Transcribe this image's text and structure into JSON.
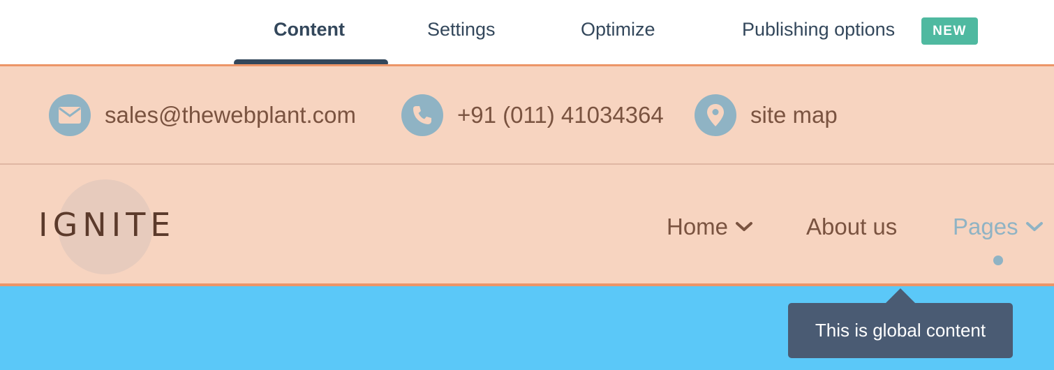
{
  "tabs": [
    {
      "label": "Content",
      "active": true
    },
    {
      "label": "Settings",
      "active": false
    },
    {
      "label": "Optimize",
      "active": false
    },
    {
      "label": "Publishing options",
      "active": false,
      "badge": "NEW"
    }
  ],
  "header": {
    "contacts": [
      {
        "icon": "envelope-icon",
        "text": "sales@thewebplant.com"
      },
      {
        "icon": "phone-icon",
        "text": "+91 (011) 41034364"
      },
      {
        "icon": "map-pin-icon",
        "text": "site map"
      }
    ],
    "logo": "IGNITE",
    "nav": [
      {
        "label": "Home",
        "has_dropdown": true,
        "active": false
      },
      {
        "label": "About us",
        "has_dropdown": false,
        "active": false
      },
      {
        "label": "Pages",
        "has_dropdown": true,
        "active": true
      }
    ]
  },
  "tooltip": {
    "text": "This is global content"
  },
  "colors": {
    "header_bg": "#f7d4c0",
    "header_border": "#ec9568",
    "icon_circle": "#8fb3c4",
    "text_brown": "#7a5340",
    "badge_green": "#4fb9a0",
    "hero_blue": "#5bc8f8",
    "tooltip_bg": "#4a5b73",
    "tab_text": "#33475b"
  }
}
